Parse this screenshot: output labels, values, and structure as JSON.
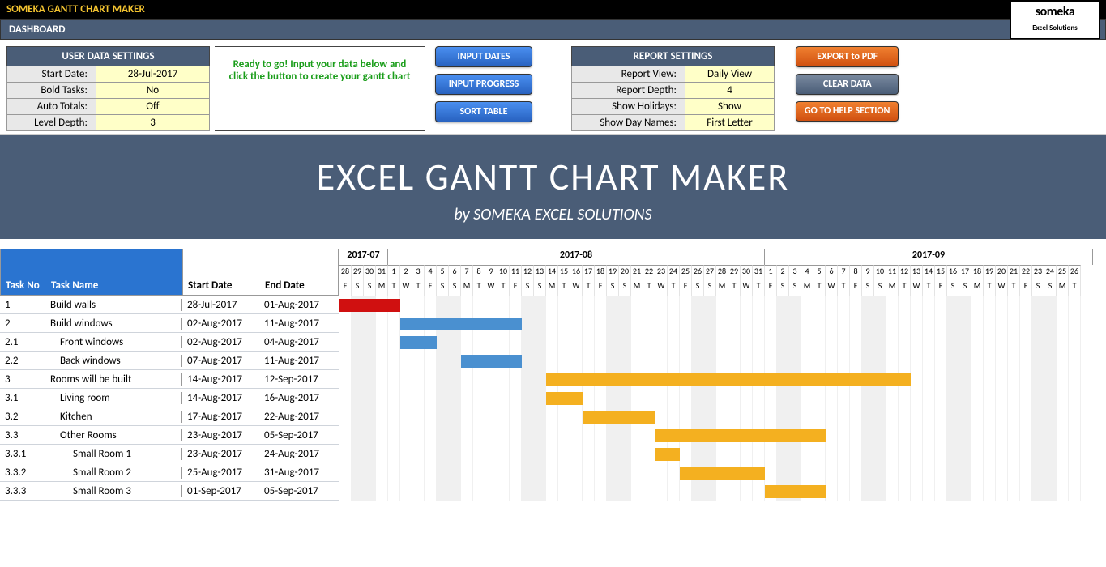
{
  "header": {
    "title": "SOMEKA GANTT CHART MAKER",
    "dashboard": "DASHBOARD",
    "logo_main": "someka",
    "logo_sub": "Excel Solutions"
  },
  "user_settings": {
    "title": "USER DATA SETTINGS",
    "rows": [
      {
        "label": "Start Date:",
        "value": "28-Jul-2017"
      },
      {
        "label": "Bold Tasks:",
        "value": "No"
      },
      {
        "label": "Auto Totals:",
        "value": "Off"
      },
      {
        "label": "Level Depth:",
        "value": "3"
      }
    ]
  },
  "ready_msg": "Ready to go! Input your data below and click the button to create your gantt chart",
  "action_buttons": {
    "input_dates": "INPUT DATES",
    "input_progress": "INPUT PROGRESS",
    "sort_table": "SORT TABLE"
  },
  "report_settings": {
    "title": "REPORT SETTINGS",
    "rows": [
      {
        "label": "Report View:",
        "value": "Daily View"
      },
      {
        "label": "Report Depth:",
        "value": "4"
      },
      {
        "label": "Show Holidays:",
        "value": "Show"
      },
      {
        "label": "Show Day Names:",
        "value": "First Letter"
      }
    ]
  },
  "right_buttons": {
    "export_pdf": "EXPORT to PDF",
    "clear_data": "CLEAR DATA",
    "help": "GO TO HELP SECTION"
  },
  "banner": {
    "title": "EXCEL GANTT CHART MAKER",
    "subtitle": "by SOMEKA EXCEL SOLUTIONS"
  },
  "columns": {
    "task_no": "Task No",
    "task_name": "Task Name",
    "start_date": "Start Date",
    "end_date": "End Date"
  },
  "months": [
    {
      "label": "2017-07",
      "span": 4
    },
    {
      "label": "2017-08",
      "span": 31
    },
    {
      "label": "2017-09",
      "span": 27
    }
  ],
  "day_numbers": [
    "28",
    "29",
    "30",
    "31",
    "1",
    "2",
    "3",
    "4",
    "5",
    "6",
    "7",
    "8",
    "9",
    "10",
    "11",
    "12",
    "13",
    "14",
    "15",
    "16",
    "17",
    "18",
    "19",
    "20",
    "21",
    "22",
    "23",
    "24",
    "25",
    "26",
    "27",
    "28",
    "29",
    "30",
    "31",
    "1",
    "2",
    "3",
    "4",
    "5",
    "6",
    "7",
    "8",
    "9",
    "10",
    "11",
    "12",
    "13",
    "14",
    "15",
    "16",
    "17",
    "18",
    "19",
    "20",
    "21",
    "22",
    "23",
    "24",
    "25",
    "26"
  ],
  "day_names": [
    "F",
    "S",
    "S",
    "M",
    "T",
    "W",
    "T",
    "F",
    "S",
    "S",
    "M",
    "T",
    "W",
    "T",
    "F",
    "S",
    "S",
    "M",
    "T",
    "W",
    "T",
    "F",
    "S",
    "S",
    "M",
    "T",
    "W",
    "T",
    "F",
    "S",
    "S",
    "M",
    "T",
    "W",
    "T",
    "F",
    "S",
    "S",
    "M",
    "T",
    "W",
    "T",
    "F",
    "S",
    "S",
    "M",
    "T",
    "W",
    "T",
    "F",
    "S",
    "S",
    "M",
    "T",
    "W",
    "T",
    "F",
    "S",
    "S",
    "M",
    "T"
  ],
  "weekends": [
    1,
    2,
    8,
    9,
    15,
    16,
    22,
    23,
    29,
    30,
    36,
    37,
    43,
    44,
    50,
    51,
    57,
    58
  ],
  "tasks": [
    {
      "no": "1",
      "name": "Build walls",
      "start": "28-Jul-2017",
      "end": "01-Aug-2017",
      "indent": 0,
      "bar_start": 0,
      "bar_len": 5,
      "color": "red"
    },
    {
      "no": "2",
      "name": "Build windows",
      "start": "02-Aug-2017",
      "end": "11-Aug-2017",
      "indent": 0,
      "bar_start": 5,
      "bar_len": 10,
      "color": "blue"
    },
    {
      "no": "2.1",
      "name": "Front windows",
      "start": "02-Aug-2017",
      "end": "04-Aug-2017",
      "indent": 1,
      "bar_start": 5,
      "bar_len": 3,
      "color": "blue"
    },
    {
      "no": "2.2",
      "name": "Back windows",
      "start": "07-Aug-2017",
      "end": "11-Aug-2017",
      "indent": 1,
      "bar_start": 10,
      "bar_len": 5,
      "color": "blue"
    },
    {
      "no": "3",
      "name": "Rooms will be built",
      "start": "14-Aug-2017",
      "end": "12-Sep-2017",
      "indent": 0,
      "bar_start": 17,
      "bar_len": 30,
      "color": "yellow"
    },
    {
      "no": "3.1",
      "name": "Living room",
      "start": "14-Aug-2017",
      "end": "16-Aug-2017",
      "indent": 1,
      "bar_start": 17,
      "bar_len": 3,
      "color": "yellow"
    },
    {
      "no": "3.2",
      "name": "Kitchen",
      "start": "17-Aug-2017",
      "end": "22-Aug-2017",
      "indent": 1,
      "bar_start": 20,
      "bar_len": 6,
      "color": "yellow"
    },
    {
      "no": "3.3",
      "name": "Other Rooms",
      "start": "23-Aug-2017",
      "end": "05-Sep-2017",
      "indent": 1,
      "bar_start": 26,
      "bar_len": 14,
      "color": "yellow"
    },
    {
      "no": "3.3.1",
      "name": "Small Room 1",
      "start": "23-Aug-2017",
      "end": "24-Aug-2017",
      "indent": 2,
      "bar_start": 26,
      "bar_len": 2,
      "color": "yellow"
    },
    {
      "no": "3.3.2",
      "name": "Small Room 2",
      "start": "25-Aug-2017",
      "end": "31-Aug-2017",
      "indent": 2,
      "bar_start": 28,
      "bar_len": 7,
      "color": "yellow"
    },
    {
      "no": "3.3.3",
      "name": "Small Room 3",
      "start": "01-Sep-2017",
      "end": "05-Sep-2017",
      "indent": 2,
      "bar_start": 35,
      "bar_len": 5,
      "color": "yellow"
    }
  ]
}
